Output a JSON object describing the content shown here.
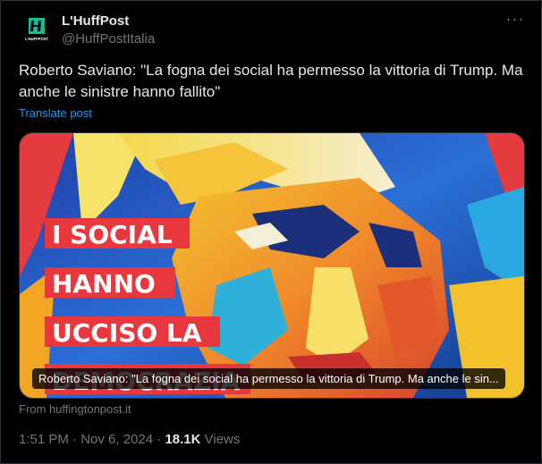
{
  "author": {
    "display_name": "L'HuffPost",
    "handle": "@HuffPostItalia",
    "avatar_text": "L'HUFFPOST",
    "avatar_icon": "huffpost-logo-icon"
  },
  "more_icon": "more-horizontal-icon",
  "more_label": "···",
  "tweet": {
    "text": "Roberto Saviano: \"La fogna dei social ha permesso la vittoria di Trump. Ma anche le sinistre hanno fallito\"",
    "translate_label": "Translate post"
  },
  "card": {
    "image_text_lines": [
      "I SOCIAL",
      "HANNO",
      "UCCISO LA",
      "DEMOCRAZIA"
    ],
    "title": "Roberto Saviano: \"La fogna dei social ha permesso la vittoria di Trump. Ma anche le sin...",
    "source": "From huffingtonpost.it"
  },
  "meta": {
    "time": "1:51 PM",
    "separator": " · ",
    "date": "Nov 6, 2024",
    "separator2": " · ",
    "views_count": "18.1K",
    "views_label": " Views"
  },
  "colors": {
    "background": "#000000",
    "text_primary": "#e7e9ea",
    "text_secondary": "#71767b",
    "link": "#1d9bf0",
    "brand_green": "#0dbe98",
    "banner_red": "#e8383d"
  }
}
